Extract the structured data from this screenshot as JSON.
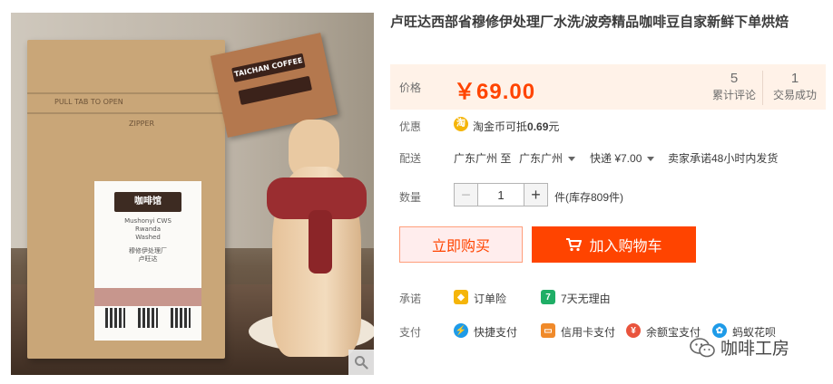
{
  "product": {
    "title": "卢旺达西部省穆修伊处理厂水洗/波旁精品咖啡豆自家新鲜下单烘焙",
    "photo": {
      "bag_texts": [
        "PULL TAB TO OPEN",
        "ZIPPER",
        "Mushonyi CWS",
        "Rwanda",
        "Washed",
        "穆修伊处理厂",
        "卢旺达"
      ],
      "card_text": "TAICHAN COFFEE",
      "zoom_icon": "magnifier-icon"
    }
  },
  "price_panel": {
    "price_label": "价格",
    "price_value": "￥69.00",
    "reviews_count": "5",
    "reviews_label": "累计评论",
    "sales_count": "1",
    "sales_label": "交易成功"
  },
  "promo": {
    "label": "优惠",
    "coin_glyph": "淘",
    "text_prefix": "淘金币可抵",
    "text_amount": "0.69",
    "text_suffix": "元"
  },
  "shipping": {
    "label": "配送",
    "from": "广东广州 至",
    "to": "广东广州",
    "method": "快递 ¥7.00",
    "promise": "卖家承诺48小时内发货"
  },
  "quantity": {
    "label": "数量",
    "value": "1",
    "stock": "件(库存809件)"
  },
  "actions": {
    "buy_now": "立即购买",
    "add_to_cart": "加入购物车"
  },
  "guarantee": {
    "label": "承诺",
    "items": [
      "订单险",
      "7天无理由"
    ]
  },
  "payment": {
    "label": "支付",
    "items": [
      "快捷支付",
      "信用卡支付",
      "余额宝支付",
      "蚂蚁花呗"
    ]
  },
  "watermark": {
    "text": "咖啡工房"
  },
  "colors": {
    "accent": "#ff4400",
    "price_bg": "#fff2e8",
    "buy_bg": "#ffeded"
  }
}
